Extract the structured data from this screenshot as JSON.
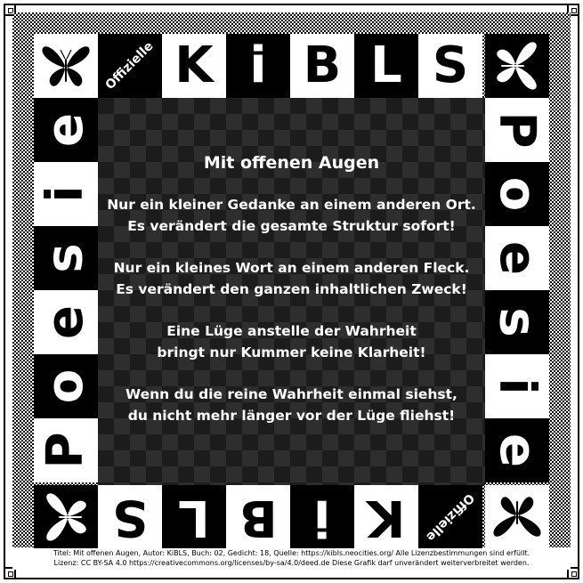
{
  "board": {
    "tag": "Offizielle",
    "top_letters": [
      "K",
      "i",
      "B",
      "L",
      "S"
    ],
    "bottom_letters": [
      "S",
      "L",
      "B",
      "i",
      "K"
    ],
    "left_letters": [
      "e",
      "i",
      "s",
      "e",
      "o",
      "P"
    ],
    "right_letters": [
      "P",
      "o",
      "e",
      "s",
      "i",
      "e"
    ]
  },
  "poem": {
    "title": "Mit offenen Augen",
    "stanzas": [
      [
        "Nur ein kleiner Gedanke an einem anderen Ort.",
        "Es verändert die gesamte Struktur sofort!"
      ],
      [
        "Nur ein kleines Wort an einem anderen Fleck.",
        "Es verändert den ganzen inhaltlichen Zweck!"
      ],
      [
        "Eine Lüge anstelle der Wahrheit",
        "bringt nur Kummer keine Klarheit!"
      ],
      [
        "Wenn du die reine Wahrheit einmal siehst,",
        "du nicht mehr länger vor der Lüge fliehst!"
      ]
    ]
  },
  "footer": {
    "line1": "Titel: Mit offenen Augen, Autor: KiBLS, Buch: 02, Gedicht: 18, Quelle: https://kibls.neocities.org/ Alle Lizenzbestimmungen sind erfüllt.",
    "line2": "Lizenz: CC BY-SA 4.0 https://creativecommons.org/licenses/by-sa/4.0/deed.de Diese Grafik darf unverändert weiterverbreitet werden."
  }
}
